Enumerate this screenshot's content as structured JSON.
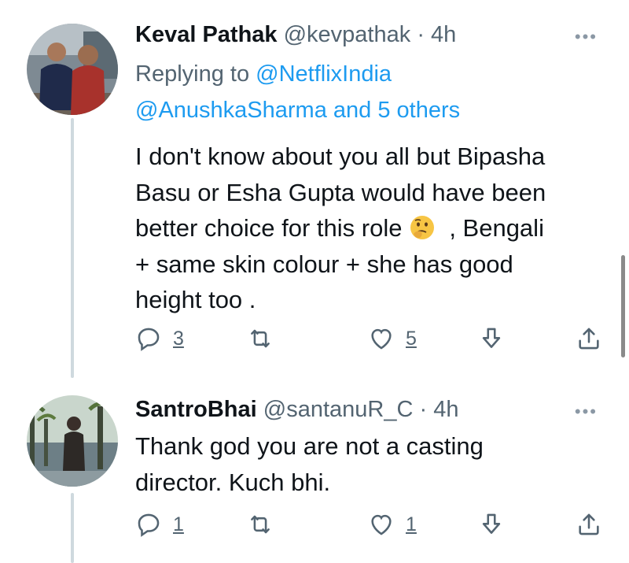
{
  "tweets": [
    {
      "name": "Keval Pathak",
      "handle": "@kevpathak",
      "dot": "·",
      "time": "4h",
      "more": "•••",
      "replying_prefix": "Replying to",
      "replying_to_1": "@NetflixIndia",
      "replying_to_2": "@AnushkaSharma and 5 others",
      "text_lines": [
        "I don't know about you all but Bipasha",
        "Basu or Esha Gupta  would have been",
        "better choice  for this role",
        ", Bengali",
        "+ same skin colour + she has good",
        "height too ."
      ],
      "emoji": "thinking-face",
      "reply_count": "3",
      "retweet_count": "",
      "like_count": "5"
    },
    {
      "name": "SantroBhai",
      "handle": "@santanuR_C",
      "dot": "·",
      "time": "4h",
      "more": "•••",
      "text_lines": [
        "Thank god you are not a casting",
        "director. Kuch bhi."
      ],
      "reply_count": "1",
      "retweet_count": "",
      "like_count": "1"
    }
  ],
  "icons": {
    "reply": "reply-icon",
    "retweet": "retweet-icon",
    "like": "heart-icon",
    "download": "download-icon",
    "share": "share-icon"
  },
  "colors": {
    "link": "#1d9bf0",
    "secondary_text": "#536471",
    "thread_line": "#cfd9de"
  }
}
